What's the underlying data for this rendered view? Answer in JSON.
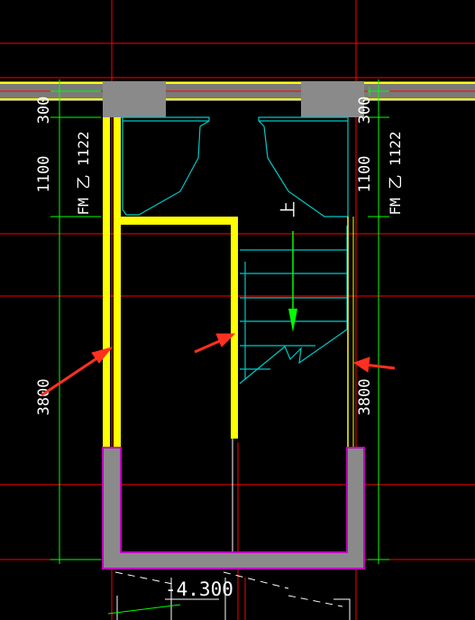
{
  "colors": {
    "background": "#000000",
    "axis": "#ff0000",
    "wall_highlight": "#ffff00",
    "dimension": "#00ff00",
    "stair": "#00c8c8",
    "pillar": "#808080",
    "outline": "#c000c0",
    "arrow": "#ff3020"
  },
  "dimensions": {
    "left_top": "300",
    "left_mid": "1100",
    "left_bottom": "3800",
    "right_top": "300",
    "right_mid": "1100",
    "right_bottom": "3800"
  },
  "door_labels": {
    "left": "FM 乙 1122",
    "right": "FM 乙 1122"
  },
  "stair_label": "上",
  "elevation": "-4.300",
  "icons": [
    "arrow-up-icon",
    "red-pointer-arrow-icon"
  ]
}
